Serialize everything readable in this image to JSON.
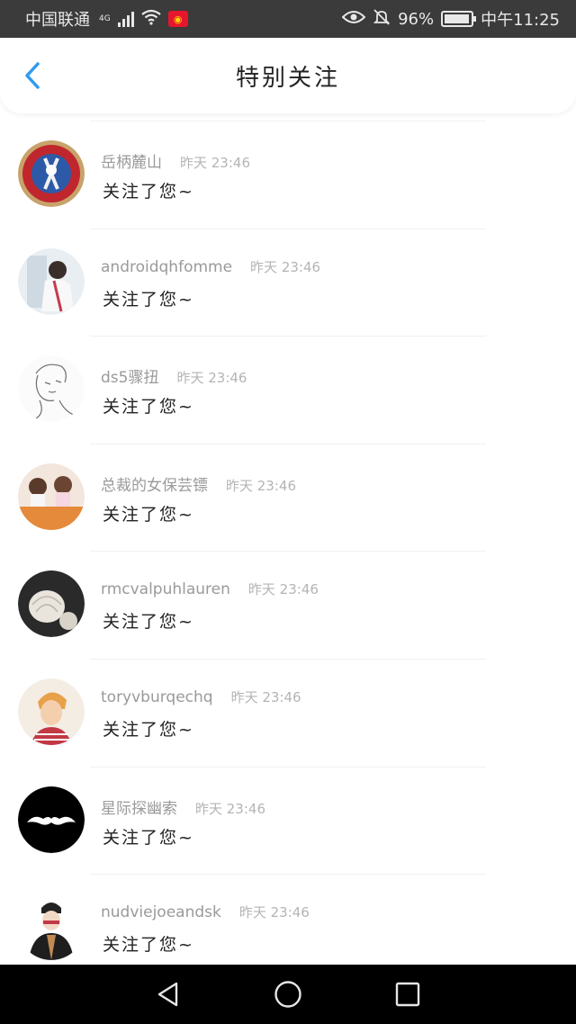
{
  "status_bar": {
    "carrier": "中国联通",
    "network": "4G",
    "battery_percent": "96%",
    "battery_level": 0.96,
    "time": "中午11:25",
    "icons": [
      "signal-icon",
      "wifi-icon",
      "weibo-icon",
      "eye-icon",
      "bell-off-icon",
      "battery-icon"
    ]
  },
  "header": {
    "title": "特别关注",
    "back_icon": "chevron-left-icon"
  },
  "items": [
    {
      "username": "岳柄麓山",
      "time": "昨天 23:46",
      "message": "关注了您~",
      "avatar": "avatar-1"
    },
    {
      "username": "androidqhfomme",
      "time": "昨天 23:46",
      "message": "关注了您~",
      "avatar": "avatar-2"
    },
    {
      "username": "ds5骤扭",
      "time": "昨天 23:46",
      "message": "关注了您~",
      "avatar": "avatar-3"
    },
    {
      "username": "总裁的女保芸镖",
      "time": "昨天 23:46",
      "message": "关注了您~",
      "avatar": "avatar-4"
    },
    {
      "username": "rmcvalpuhlauren",
      "time": "昨天 23:46",
      "message": "关注了您~",
      "avatar": "avatar-5"
    },
    {
      "username": "toryvburqechq",
      "time": "昨天 23:46",
      "message": "关注了您~",
      "avatar": "avatar-6"
    },
    {
      "username": "星际探幽索",
      "time": "昨天 23:46",
      "message": "关注了您~",
      "avatar": "avatar-7"
    },
    {
      "username": "nudviejoeandsk",
      "time": "昨天 23:46",
      "message": "关注了您~",
      "avatar": "avatar-8"
    }
  ],
  "nav": {
    "back_icon": "triangle-back-icon",
    "home_icon": "circle-home-icon",
    "recents_icon": "square-recents-icon"
  },
  "colors": {
    "status_bar_bg": "#3b3b3b",
    "accent": "#2f9bf0",
    "nav_bar_bg": "#000000"
  }
}
